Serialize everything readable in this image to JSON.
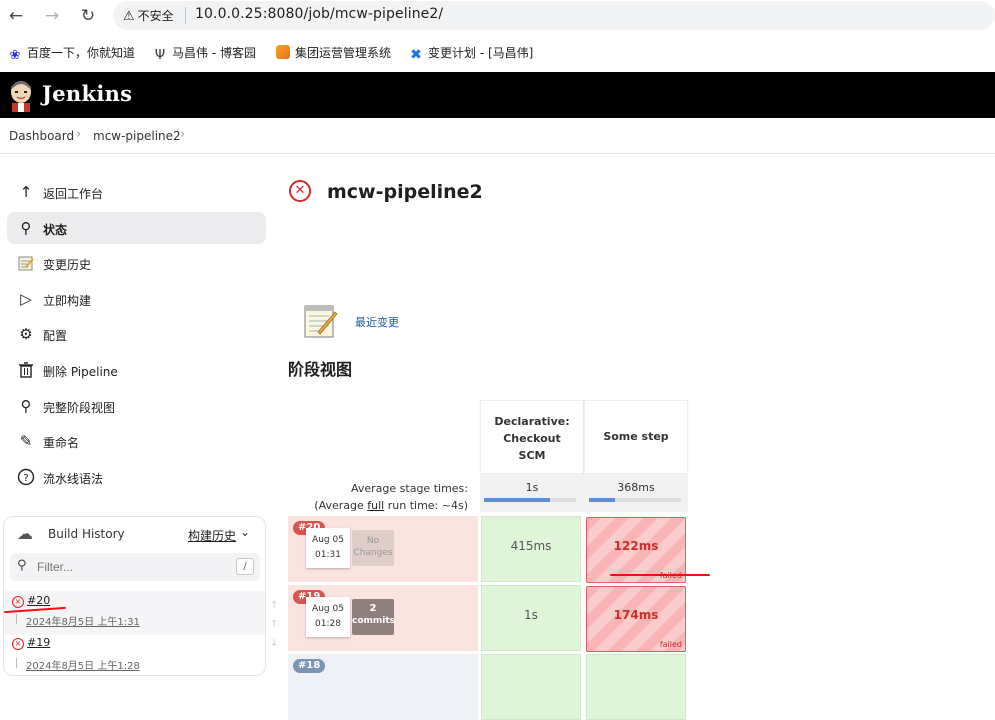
{
  "browser": {
    "insecure_label": "不安全",
    "url": "10.0.0.25:8080/job/mcw-pipeline2/",
    "bookmarks": [
      "百度一下，你就知道",
      "马昌伟 - 博客园",
      "集团运营管理系统",
      "变更计划 - [马昌伟]"
    ]
  },
  "header": {
    "app_name": "Jenkins"
  },
  "breadcrumb": [
    "Dashboard",
    "mcw-pipeline2"
  ],
  "sidebar": {
    "items": [
      {
        "label": "返回工作台",
        "icon": "arrow-up-icon"
      },
      {
        "label": "状态",
        "icon": "search-icon"
      },
      {
        "label": "变更历史",
        "icon": "notepad-icon"
      },
      {
        "label": "立即构建",
        "icon": "play-icon"
      },
      {
        "label": "配置",
        "icon": "gear-icon"
      },
      {
        "label": "删除 Pipeline",
        "icon": "trash-icon"
      },
      {
        "label": "完整阶段视图",
        "icon": "search-icon"
      },
      {
        "label": "重命名",
        "icon": "pencil-icon"
      },
      {
        "label": "流水线语法",
        "icon": "help-icon"
      }
    ]
  },
  "build_history": {
    "title": "Build History",
    "trend_label": "构建历史",
    "filter_placeholder": "Filter...",
    "filter_shortcut": "/",
    "builds": [
      {
        "number": "#20",
        "date": "2024年8月5日 上午1:31",
        "status": "failed"
      },
      {
        "number": "#19",
        "date": "2024年8月5日 上午1:28",
        "status": "failed"
      }
    ]
  },
  "main": {
    "title": "mcw-pipeline2",
    "recent_changes_label": "最近变更",
    "stage_view_heading": "阶段视图"
  },
  "stage_view": {
    "columns": [
      {
        "name_lines": [
          "Declarative:",
          "Checkout",
          "SCM"
        ],
        "avg": "1s",
        "avg_fill": 0.72
      },
      {
        "name_lines": [
          "Some step"
        ],
        "avg": "368ms",
        "avg_fill": 0.28
      }
    ],
    "avg_label": "Average stage times:",
    "avg_full_prefix": "(Average ",
    "avg_full_link": "full",
    "avg_full_suffix": " run time: ~4s)",
    "runs": [
      {
        "badge": "#20",
        "month_day": "Aug 05",
        "time": "01:31",
        "changes_lines": [
          "No",
          "Changes"
        ],
        "changes_kind": "none",
        "cells": [
          {
            "value": "415ms",
            "status": "success"
          },
          {
            "value": "122ms",
            "status": "failed",
            "tag": "failed"
          }
        ]
      },
      {
        "badge": "#19",
        "month_day": "Aug 05",
        "time": "01:28",
        "changes_lines": [
          "2",
          "commits"
        ],
        "changes_kind": "some",
        "cells": [
          {
            "value": "1s",
            "status": "success"
          },
          {
            "value": "174ms",
            "status": "failed",
            "tag": "failed"
          }
        ]
      },
      {
        "badge": "#18",
        "month_day": "",
        "time": "",
        "changes_lines": [],
        "changes_kind": "none",
        "cells": []
      }
    ]
  },
  "colors": {
    "failed_red": "#d62a2a",
    "link_blue": "#1d5ea8",
    "success_green": "#dff5d8",
    "header_black": "#000000"
  }
}
